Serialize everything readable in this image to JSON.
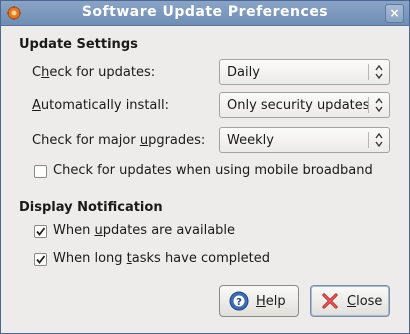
{
  "window": {
    "title": "Software Update Preferences"
  },
  "update_settings": {
    "heading": "Update Settings",
    "check_label_pre": "C",
    "check_label_u": "h",
    "check_label_post": "eck for updates:",
    "check_value": "Daily",
    "auto_label_pre": "",
    "auto_label_u": "A",
    "auto_label_post": "utomatically install:",
    "auto_value": "Only security updates",
    "major_label_pre": "Check for major ",
    "major_label_u": "u",
    "major_label_post": "pgrades:",
    "major_value": "Weekly",
    "mobile_checkbox_label": "Check for updates when using mobile broadband",
    "mobile_checked": false
  },
  "display_notification": {
    "heading": "Display Notification",
    "updates_label_pre": "When ",
    "updates_label_u": "u",
    "updates_label_post": "pdates are available",
    "updates_checked": true,
    "tasks_label_pre": "When long ",
    "tasks_label_u": "t",
    "tasks_label_post": "asks have completed",
    "tasks_checked": true
  },
  "buttons": {
    "help_pre": "",
    "help_u": "H",
    "help_post": "elp",
    "close_pre": "",
    "close_u": "C",
    "close_post": "lose"
  },
  "icons": {
    "app": "software-update-icon",
    "help": "help-icon",
    "close": "close-icon"
  }
}
